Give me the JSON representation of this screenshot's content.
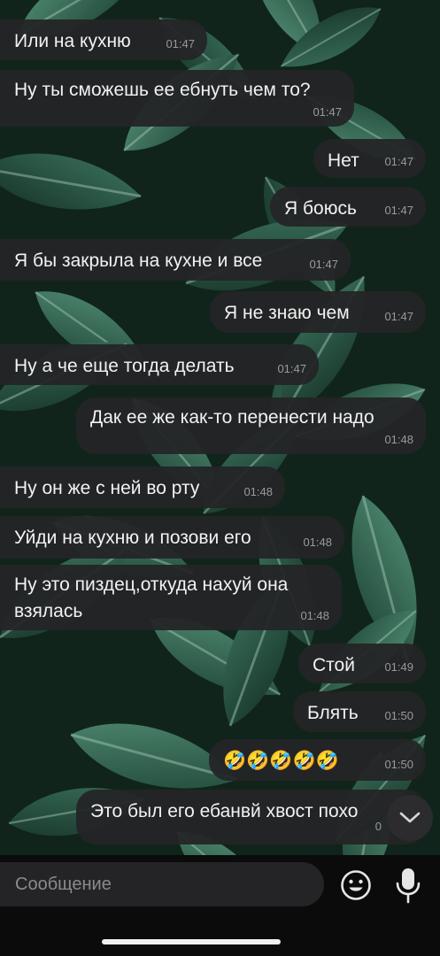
{
  "messages": [
    {
      "text": "Или на кухню",
      "time": "01:47",
      "side": "in"
    },
    {
      "text": "Ну ты сможешь ее ебнуть чем то?",
      "time": "01:47",
      "side": "in"
    },
    {
      "text": "Нет",
      "time": "01:47",
      "side": "out"
    },
    {
      "text": "Я боюсь",
      "time": "01:47",
      "side": "out"
    },
    {
      "text": "Я бы закрыла на кухне и все",
      "time": "01:47",
      "side": "in"
    },
    {
      "text": "Я не знаю чем",
      "time": "01:47",
      "side": "out"
    },
    {
      "text": "Ну а че еще тогда делать",
      "time": "01:47",
      "side": "in"
    },
    {
      "text": "Дак ее же как-то перенести надо",
      "time": "01:48",
      "side": "out"
    },
    {
      "text": "Ну он же с ней во рту",
      "time": "01:48",
      "side": "in"
    },
    {
      "text": "Уйди на кухню и позови его",
      "time": "01:48",
      "side": "in"
    },
    {
      "text": "Ну это пиздец,откуда нахуй она взялась",
      "time": "01:48",
      "side": "in"
    },
    {
      "text": "Стой",
      "time": "01:49",
      "side": "out"
    },
    {
      "text": "Блять",
      "time": "01:50",
      "side": "out"
    },
    {
      "text": "🤣🤣🤣🤣🤣",
      "time": "01:50",
      "side": "out"
    },
    {
      "text": "Это был его ебанвй хвост похо",
      "time": "0",
      "side": "out"
    }
  ],
  "composer": {
    "placeholder": "Сообщение",
    "emoji_icon": "smiley-icon",
    "mic_icon": "microphone-icon"
  },
  "scroll_down_icon": "chevron-down-icon",
  "colors": {
    "bubble": "#242426",
    "text": "#f2f2f2",
    "time": "#9a9a9a",
    "background_leaves": "#2f5a47",
    "bottom_bar": "#0b0b0b"
  }
}
